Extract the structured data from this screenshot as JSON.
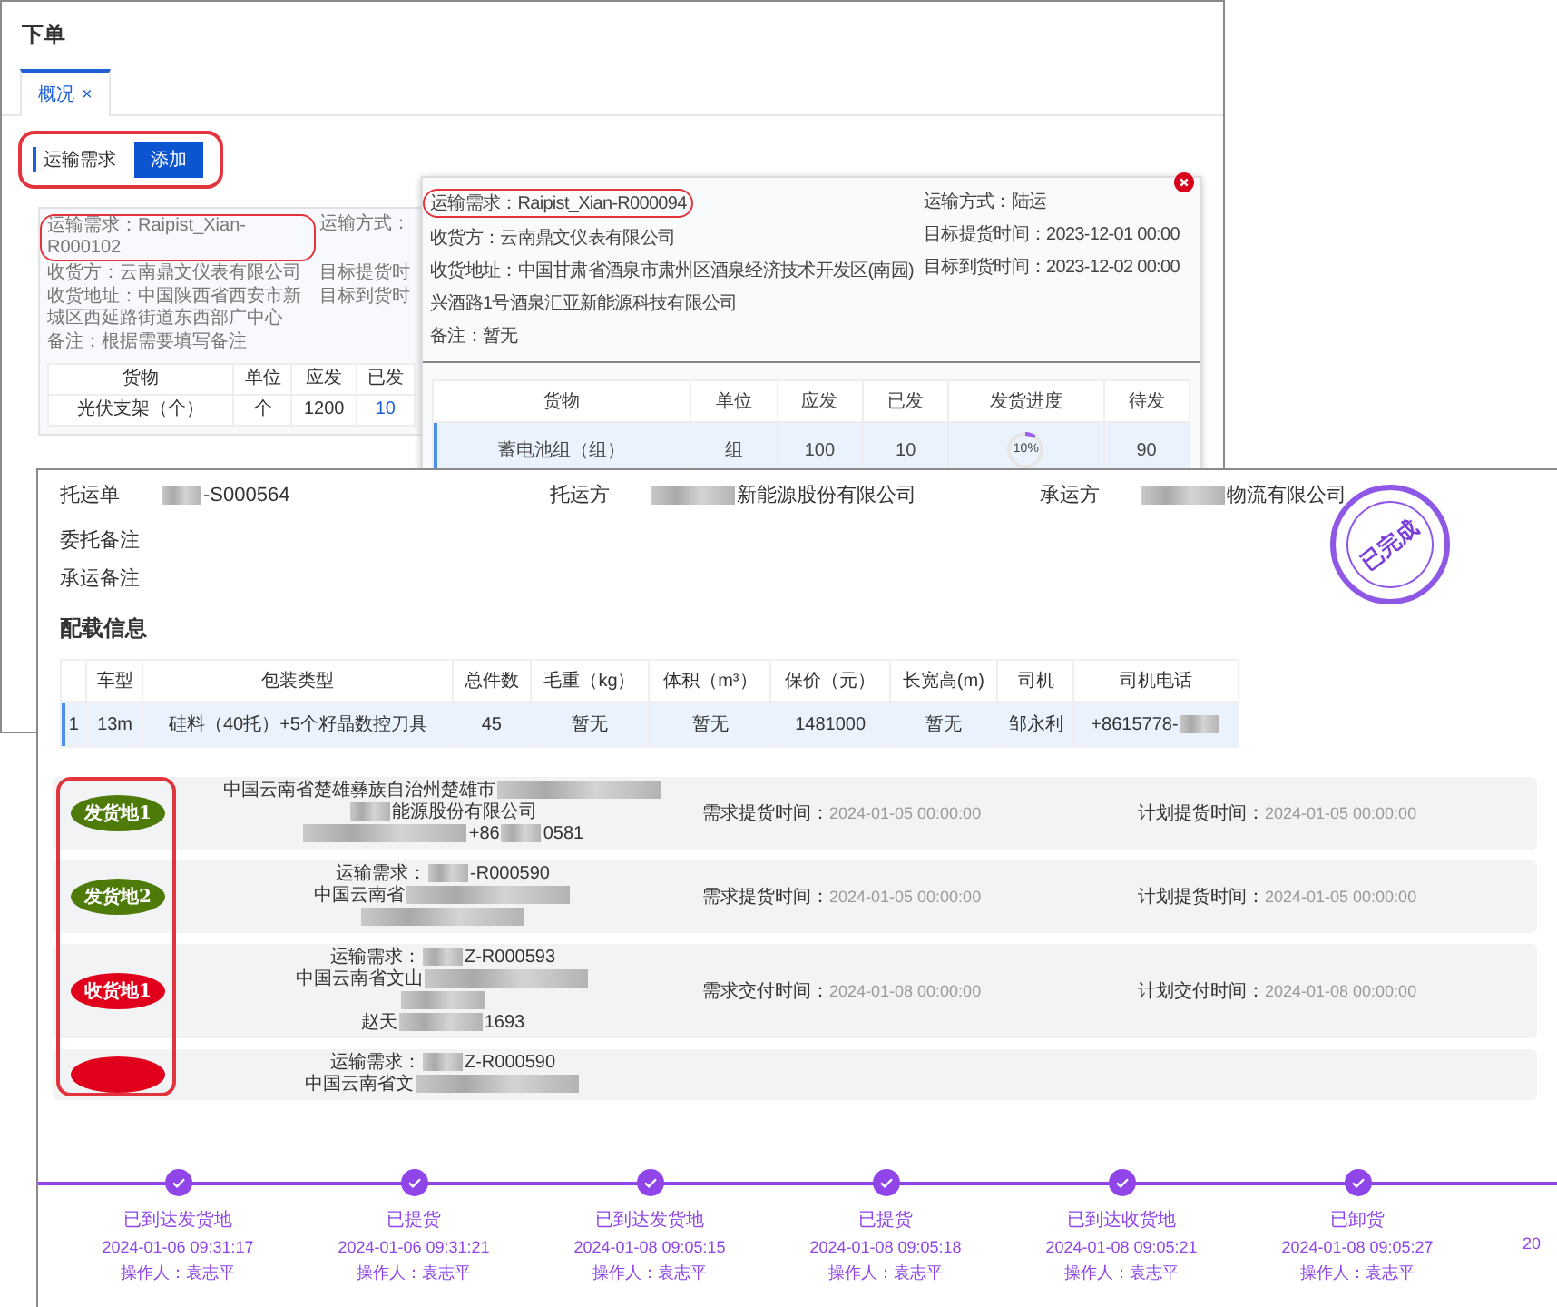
{
  "back_window": {
    "title": "下单",
    "tabs": [
      {
        "label": "概况",
        "close": "×",
        "selected": true
      }
    ],
    "section": {
      "title": "运输需求",
      "button": "添加"
    },
    "request": {
      "left_fields": [
        "运输需求：Raipist_Xian-R000102",
        "收货方：云南鼎文仪表有限公司",
        "收货地址：中国陕西省西安市新城区西延路街道东西部广中心",
        "备注：根据需要填写备注"
      ],
      "right_fields": [
        "运输方式：",
        "目标提货时",
        "目标到货时"
      ],
      "table": {
        "columns": [
          "货物",
          "单位",
          "应发",
          "已发"
        ],
        "rows": [
          [
            "光伏支架（个）",
            "个",
            "1200",
            "10"
          ]
        ]
      }
    }
  },
  "popup": {
    "fields_left": [
      "运输需求：Raipist_Xian-R000094",
      "收货方：云南鼎文仪表有限公司",
      "收货地址：中国甘肃省酒泉市肃州区酒泉经济技术开发区(南园)",
      "兴酒路1号酒泉汇亚新能源科技有限公司",
      "备注：暂无"
    ],
    "fields_right": [
      "运输方式：陆运",
      "目标提货时间：2023-12-01 00:00",
      "目标到货时间：2023-12-02 00:00"
    ],
    "table": {
      "columns": [
        "货物",
        "单位",
        "应发",
        "已发",
        "发货进度",
        "待发"
      ],
      "rows": [
        {
          "selected": true,
          "cells": [
            "蓄电池组（组）",
            "组",
            "100",
            "10"
          ],
          "progress": {
            "level": 0.1,
            "reading": "10%"
          },
          "remaining": "90"
        }
      ]
    }
  },
  "waybill": {
    "header": [
      {
        "label": "托运单",
        "value": [
          {
            "kind": "mask_short"
          },
          {
            "kind": "text",
            "text": "-S000564"
          }
        ]
      },
      {
        "label": "托运方",
        "value": [
          {
            "kind": "mask_medium"
          },
          {
            "kind": "text",
            "text": "新能源股份有限公司"
          }
        ]
      },
      {
        "label": "承运方",
        "value": [
          {
            "kind": "mask_medium"
          },
          {
            "kind": "text",
            "text": "物流有限公司"
          }
        ]
      }
    ],
    "notes": [
      "委托备注",
      "承运备注"
    ],
    "stamp": "已完成",
    "section_title": "配载信息",
    "table": {
      "columns": [
        "车型",
        "包装类型",
        "总件数",
        "毛重（kg）",
        "体积（m³）",
        "保价（元）",
        "长宽高(m)",
        "司机",
        "司机电话"
      ],
      "rows": [
        {
          "selected": true,
          "index": "1",
          "cells": [
            [
              {
                "kind": "text",
                "text": "13m"
              }
            ],
            [
              {
                "kind": "text",
                "text": "硅料（40托）+5个籽晶数控刀具"
              }
            ],
            [
              {
                "kind": "text",
                "text": "45"
              }
            ],
            [
              {
                "kind": "text",
                "text": "暂无"
              }
            ],
            [
              {
                "kind": "text",
                "text": "暂无"
              }
            ],
            [
              {
                "kind": "text",
                "text": "1481000"
              }
            ],
            [
              {
                "kind": "text",
                "text": "暂无"
              }
            ],
            [
              {
                "kind": "text",
                "text": "邹永利"
              }
            ],
            [
              {
                "kind": "text",
                "text": "+8615778-"
              },
              {
                "kind": "mask_short"
              }
            ]
          ]
        }
      ]
    },
    "stops": [
      {
        "badge": "发货地1",
        "color": "#4d7a08",
        "lines": [
          [
            {
              "kind": "text",
              "text": "中国云南省楚雄彝族自治州楚雄市"
            },
            {
              "kind": "mask_long"
            }
          ],
          [
            {
              "kind": "mask_short"
            },
            {
              "kind": "text",
              "text": "能源股份有限公司"
            }
          ],
          [
            {
              "kind": "mask_long"
            },
            {
              "kind": "text",
              "text": "+86"
            },
            {
              "kind": "mask_short"
            },
            {
              "kind": "text",
              "text": "0581"
            }
          ]
        ],
        "times": [
          {
            "label": "需求提货时间：",
            "value": "2024-01-05 00:00:00"
          },
          {
            "label": "计划提货时间：",
            "value": "2024-01-05 00:00:00"
          }
        ]
      },
      {
        "badge": "发货地2",
        "color": "#4d7a08",
        "lines": [
          [
            {
              "kind": "text",
              "text": "运输需求："
            },
            {
              "kind": "mask_short"
            },
            {
              "kind": "text",
              "text": "-R000590"
            }
          ],
          [
            {
              "kind": "text",
              "text": "中国云南省"
            },
            {
              "kind": "mask_long"
            }
          ],
          [
            {
              "kind": "mask_long"
            }
          ]
        ],
        "times": [
          {
            "label": "需求提货时间：",
            "value": "2024-01-05 00:00:00"
          },
          {
            "label": "计划提货时间：",
            "value": "2024-01-05 00:00:00"
          }
        ]
      },
      {
        "badge": "收货地1",
        "color": "#e0001b",
        "lines": [
          [
            {
              "kind": "text",
              "text": "运输需求："
            },
            {
              "kind": "mask_short"
            },
            {
              "kind": "text",
              "text": "Z-R000593"
            }
          ],
          [
            {
              "kind": "text",
              "text": "中国云南省文山"
            },
            {
              "kind": "mask_long"
            }
          ],
          [
            {
              "kind": "mask_medium"
            }
          ],
          [
            {
              "kind": "text",
              "text": "赵天"
            },
            {
              "kind": "mask_medium"
            },
            {
              "kind": "text",
              "text": "1693"
            }
          ]
        ],
        "times": [
          {
            "label": "需求交付时间：",
            "value": "2024-01-08 00:00:00"
          },
          {
            "label": "计划交付时间：",
            "value": "2024-01-08 00:00:00"
          }
        ]
      },
      {
        "color": "#e0001b",
        "lines": [
          [
            {
              "kind": "text",
              "text": "运输需求："
            },
            {
              "kind": "mask_short"
            },
            {
              "kind": "text",
              "text": "Z-R000590"
            }
          ],
          [
            {
              "kind": "text",
              "text": "中国云南省文"
            },
            {
              "kind": "mask_long"
            }
          ]
        ]
      }
    ],
    "timeline": [
      {
        "status": "已到达发货地",
        "time": "2024-01-06 09:31:17",
        "operator": "操作人：袁志平"
      },
      {
        "status": "已提货",
        "time": "2024-01-06 09:31:21",
        "operator": "操作人：袁志平"
      },
      {
        "status": "已到达发货地",
        "time": "2024-01-08 09:05:15",
        "operator": "操作人：袁志平"
      },
      {
        "status": "已提货",
        "time": "2024-01-08 09:05:18",
        "operator": "操作人：袁志平"
      },
      {
        "status": "已到达收货地",
        "time": "2024-01-08 09:05:21",
        "operator": "操作人：袁志平"
      },
      {
        "status": "已卸货",
        "time": "2024-01-08 09:05:27",
        "operator": "操作人：袁志平"
      },
      {
        "time": "20"
      }
    ]
  }
}
